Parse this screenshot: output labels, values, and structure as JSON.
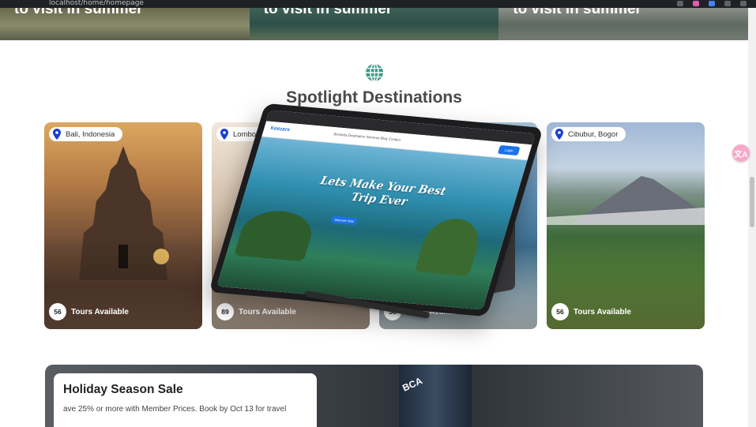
{
  "browser": {
    "url": "localhost/home/homepage",
    "icons": [
      "back-icon",
      "extension-icon",
      "profile-icon",
      "menu-icon"
    ]
  },
  "hero_cards": [
    {
      "title": "to visit in summer"
    },
    {
      "title": "to visit in summer"
    },
    {
      "title": "to visit in summer"
    }
  ],
  "section": {
    "icon": "globe-icon",
    "title": "Spotlight Destinations",
    "accent_color": "#3f9b8a"
  },
  "destinations": [
    {
      "location": "Bali, Indonesia",
      "count": "56",
      "label": "Tours Available"
    },
    {
      "location": "Lombok, Indonesia",
      "count": "89",
      "label": "Tours Available"
    },
    {
      "location": "",
      "count": "56",
      "label": "Tours Available"
    },
    {
      "location": "Cibubur, Bogor",
      "count": "56",
      "label": "Tours Available"
    }
  ],
  "mockup": {
    "logo": "Keezars",
    "nav_links": "Beranda   Destination   Services   Blog   Contact",
    "login": "Login",
    "headline_line1": "Lets Make Your Best",
    "headline_line2": "Trip Ever",
    "cta": "Discover Now"
  },
  "translate_widget": {
    "icon": "translate-icon",
    "label": "文A"
  },
  "banner": {
    "title": "Holiday Season Sale",
    "text": "ave 25% or more with Member Prices. Book by Oct 13 for travel",
    "tower_logo": "BCA"
  }
}
